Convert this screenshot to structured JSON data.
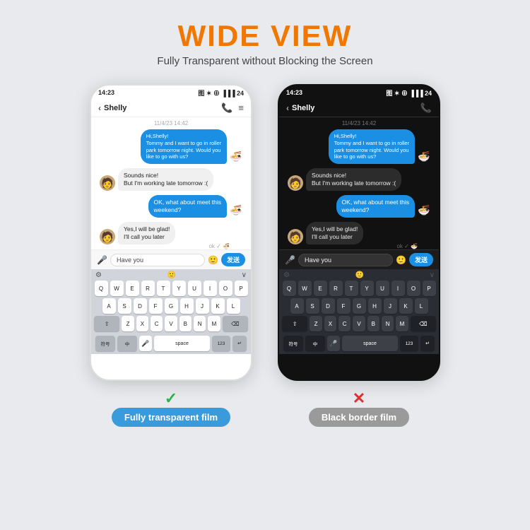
{
  "header": {
    "title": "WIDE VIEW",
    "subtitle": "Fully Transparent without Blocking the Screen"
  },
  "phone_left": {
    "type": "white",
    "status_time": "14:23",
    "status_icons": "图 寒 令 .ill 24",
    "contact": "Shelly",
    "date": "11/4/23 14:42",
    "messages": [
      {
        "type": "sent",
        "text": "Hi,Shelly!\nTommy and I want to go in roller\npark tomorrow night. Would you\nlike to go with us?"
      },
      {
        "type": "received",
        "text": "Sounds nice!\nBut I'm working late tomorrow :("
      },
      {
        "type": "sent",
        "text": "OK, what about meet this\nweekend?"
      },
      {
        "type": "received",
        "text": "Yes,I will be glad!\nI'll call you later"
      }
    ],
    "ok_status": "ok ✓",
    "input_text": "Have you",
    "send_label": "发送",
    "keyboard_rows": [
      [
        "Q",
        "W",
        "E",
        "R",
        "T",
        "Y",
        "U",
        "I",
        "O",
        "P"
      ],
      [
        "A",
        "S",
        "D",
        "F",
        "G",
        "H",
        "J",
        "K",
        "L"
      ],
      [
        "Z",
        "X",
        "C",
        "V",
        "B",
        "N",
        "M"
      ]
    ]
  },
  "phone_right": {
    "type": "dark",
    "status_time": "14:23",
    "status_icons": "图 寒 令 .ill 24",
    "contact": "Shelly",
    "date": "11/4/23 14:42",
    "messages": [
      {
        "type": "sent",
        "text": "Hi,Shelly!\nTommy and I want to go in roller\npark tomorrow night. Would you\nlike to go with us?"
      },
      {
        "type": "received",
        "text": "Sounds nice!\nBut I'm working late tomorrow :("
      },
      {
        "type": "sent",
        "text": "OK, what about meet this\nweekend?"
      },
      {
        "type": "received",
        "text": "Yes,I will be glad!\nI'll call you later"
      }
    ],
    "ok_status": "ok ✓",
    "input_text": "Have you",
    "send_label": "发送",
    "keyboard_rows": [
      [
        "Q",
        "W",
        "E",
        "R",
        "T",
        "Y",
        "U",
        "I",
        "O",
        "P"
      ],
      [
        "A",
        "S",
        "D",
        "F",
        "G",
        "H",
        "J",
        "K",
        "L"
      ],
      [
        "Z",
        "X",
        "C",
        "V",
        "B",
        "N",
        "M"
      ]
    ]
  },
  "labels": {
    "left_check": "✓",
    "left_label": "Fully transparent film",
    "right_cross": "✕",
    "right_label": "Black border film"
  }
}
